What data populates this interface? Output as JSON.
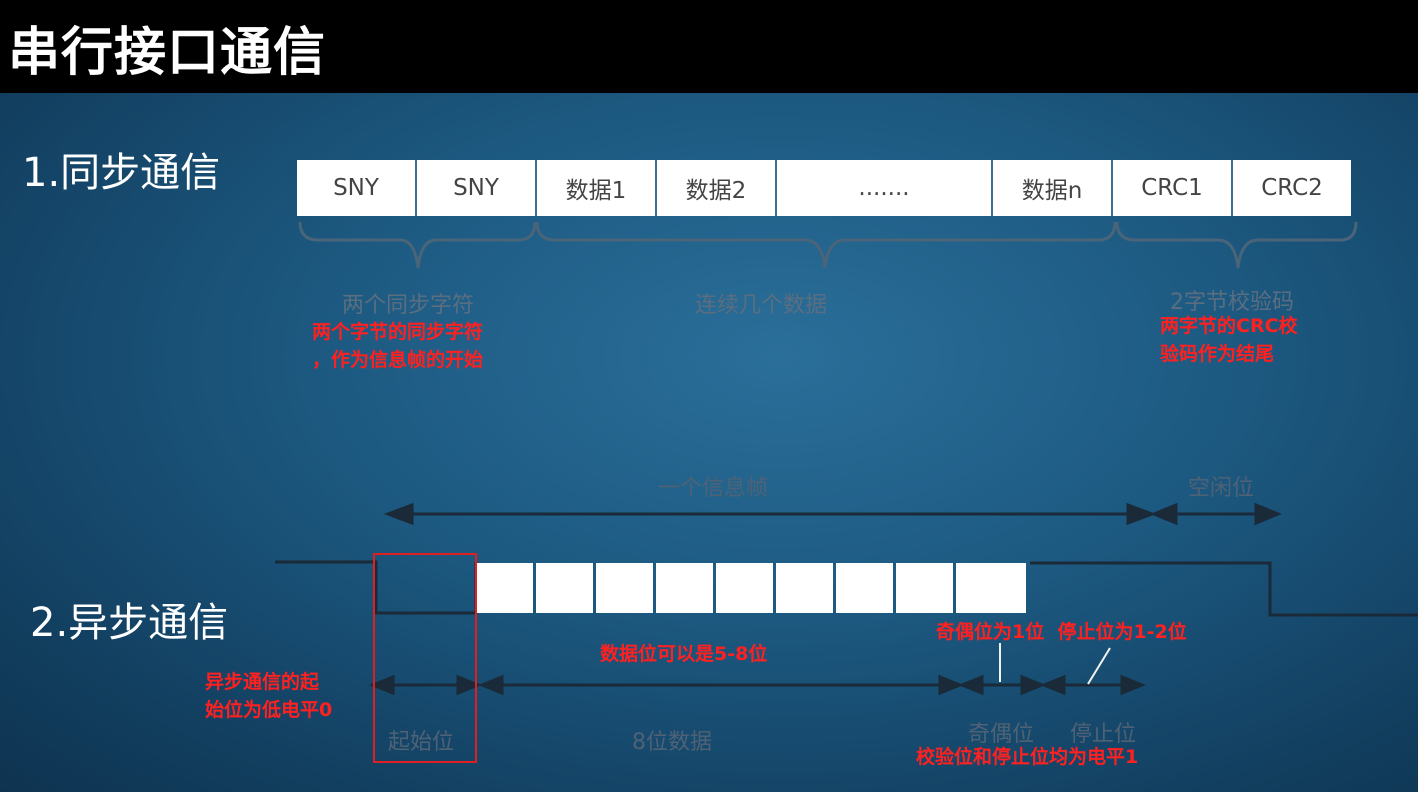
{
  "title": "串行接口通信",
  "sync": {
    "heading": "1.同步通信",
    "cells": [
      "SNY",
      "SNY",
      "数据1",
      "数据2",
      ".......",
      "数据n",
      "CRC1",
      "CRC2"
    ],
    "brace_labels": [
      "两个同步字符",
      "连续几个数据",
      "2字节校验码"
    ],
    "note_sync": [
      "两个字节的同步字符",
      "，作为信息帧的开始"
    ],
    "note_crc": [
      "两字节的CRC校",
      "验码作为结尾"
    ]
  },
  "async": {
    "heading": "2.异步通信",
    "frame_label": "一个信息帧",
    "idle_label": "空闲位",
    "bottom_labels": [
      "起始位",
      "8位数据",
      "奇偶位",
      "停止位"
    ],
    "note_data": "数据位可以是5-8位",
    "note_parity_stop": "奇偶位为1位  停止位为1-2位",
    "note_start": [
      "异步通信的起",
      "始位为低电平0"
    ],
    "note_levels": "校验位和停止位均为电平1"
  }
}
